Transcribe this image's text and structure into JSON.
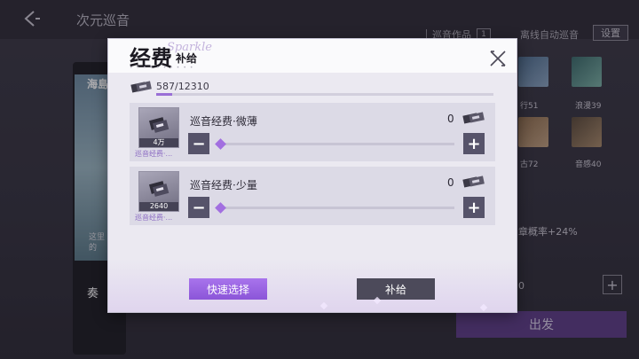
{
  "background": {
    "title": "次元巡音",
    "works_label": "巡音作品",
    "works_count": "1",
    "auto_label": "离线自动巡音",
    "settings_label": "设置",
    "film_label": "海島",
    "film_caption": "这里的",
    "film_label2": "奏",
    "thumbs": [
      "行51",
      "浪漫39",
      "古72",
      "音感40"
    ],
    "rate_text": "章概率+24%",
    "zero_text": "0",
    "plus_label": "+",
    "depart_label": "出发",
    "colors": {
      "depart": "#5c3c86"
    }
  },
  "modal": {
    "title": "经费",
    "subtitle": "补给",
    "deco": "Sparkle",
    "balance": {
      "text": "587/12310",
      "current": 587,
      "max": 12310
    },
    "items": [
      {
        "name": "巡音经费·微薄",
        "thumb_qty": "4万",
        "tag": "巡音经费·...",
        "count": "0",
        "slider_value": 0
      },
      {
        "name": "巡音经费·少量",
        "thumb_qty": "2640",
        "tag": "巡音经费·...",
        "count": "0",
        "slider_value": 0
      }
    ],
    "minus_label": "−",
    "plus_label": "+",
    "quick_select_label": "快速选择",
    "supply_label": "补给",
    "colors": {
      "accent": "#9a6fd6",
      "dark_button": "#4c4a5a"
    }
  }
}
